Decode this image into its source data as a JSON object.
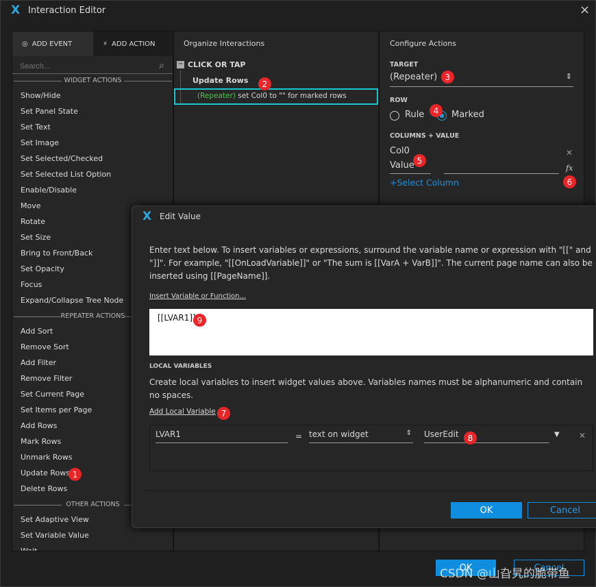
{
  "window": {
    "title": "Interaction Editor",
    "close": "×"
  },
  "left": {
    "tabs": {
      "event": "ADD EVENT",
      "action": "ADD ACTION"
    },
    "search_placeholder": "Search...",
    "sections": {
      "widget": "WIDGET ACTIONS",
      "repeater": "REPEATER ACTIONS",
      "other": "OTHER ACTIONS"
    },
    "widget_items": [
      "Show/Hide",
      "Set Panel State",
      "Set Text",
      "Set Image",
      "Set Selected/Checked",
      "Set Selected List Option",
      "Enable/Disable",
      "Move",
      "Rotate",
      "Set Size",
      "Bring to Front/Back",
      "Set Opacity",
      "Focus",
      "Expand/Collapse Tree Node"
    ],
    "repeater_items": [
      "Add Sort",
      "Remove Sort",
      "Add Filter",
      "Remove Filter",
      "Set Current Page",
      "Set Items per Page",
      "Add Rows",
      "Mark Rows",
      "Unmark Rows",
      "Update Rows",
      "Delete Rows"
    ],
    "other_items": [
      "Set Adaptive View",
      "Set Variable Value",
      "Wait"
    ]
  },
  "middle": {
    "title": "Organize Interactions",
    "event": "CLICK OR TAP",
    "action": "Update Rows",
    "detail_target": "(Repeater)",
    "detail_text": " set Col0 to \"\" for marked rows"
  },
  "right": {
    "title": "Configure Actions",
    "target_label": "TARGET",
    "target_value": "(Repeater)",
    "row_label": "ROW",
    "row_options": [
      "Rule",
      "Marked"
    ],
    "row_selected": "Marked",
    "columns_label": "COLUMNS + VALUE",
    "column": "Col0",
    "value_type": "Value",
    "fx": "fx",
    "select_column": "+Select Column"
  },
  "dialog": {
    "title": "Edit Value",
    "instructions": "Enter text below. To insert variables or expressions, surround the variable name or expression with \"[[\" and \"]]\". For example, \"[[OnLoadVariable]]\" or \"The sum is [[VarA + VarB]]\". The current page name can also be inserted using [[PageName]].",
    "insert_link": "Insert Variable or Function...",
    "value": "[[LVAR1]]",
    "local_label": "LOCAL VARIABLES",
    "local_desc": "Create local variables to insert widget values above. Variables names must be alphanumeric and contain no spaces.",
    "add_local": "Add Local Variable",
    "var": {
      "name": "LVAR1",
      "eq": "=",
      "type": "text on widget",
      "widget": "UserEdit"
    },
    "ok": "OK",
    "cancel": "Cancel"
  },
  "footer": {
    "ok": "OK",
    "cancel": "Cancel"
  },
  "watermark": "CSDN @山旮旯的脆带鱼",
  "badges": [
    "1",
    "2",
    "3",
    "4",
    "5",
    "6",
    "7",
    "8",
    "9"
  ],
  "colors": {
    "accent": "#0f8ee0",
    "selection": "#19c8d0",
    "repeater_green": "#4fc34f",
    "badge": "#e8262a"
  }
}
